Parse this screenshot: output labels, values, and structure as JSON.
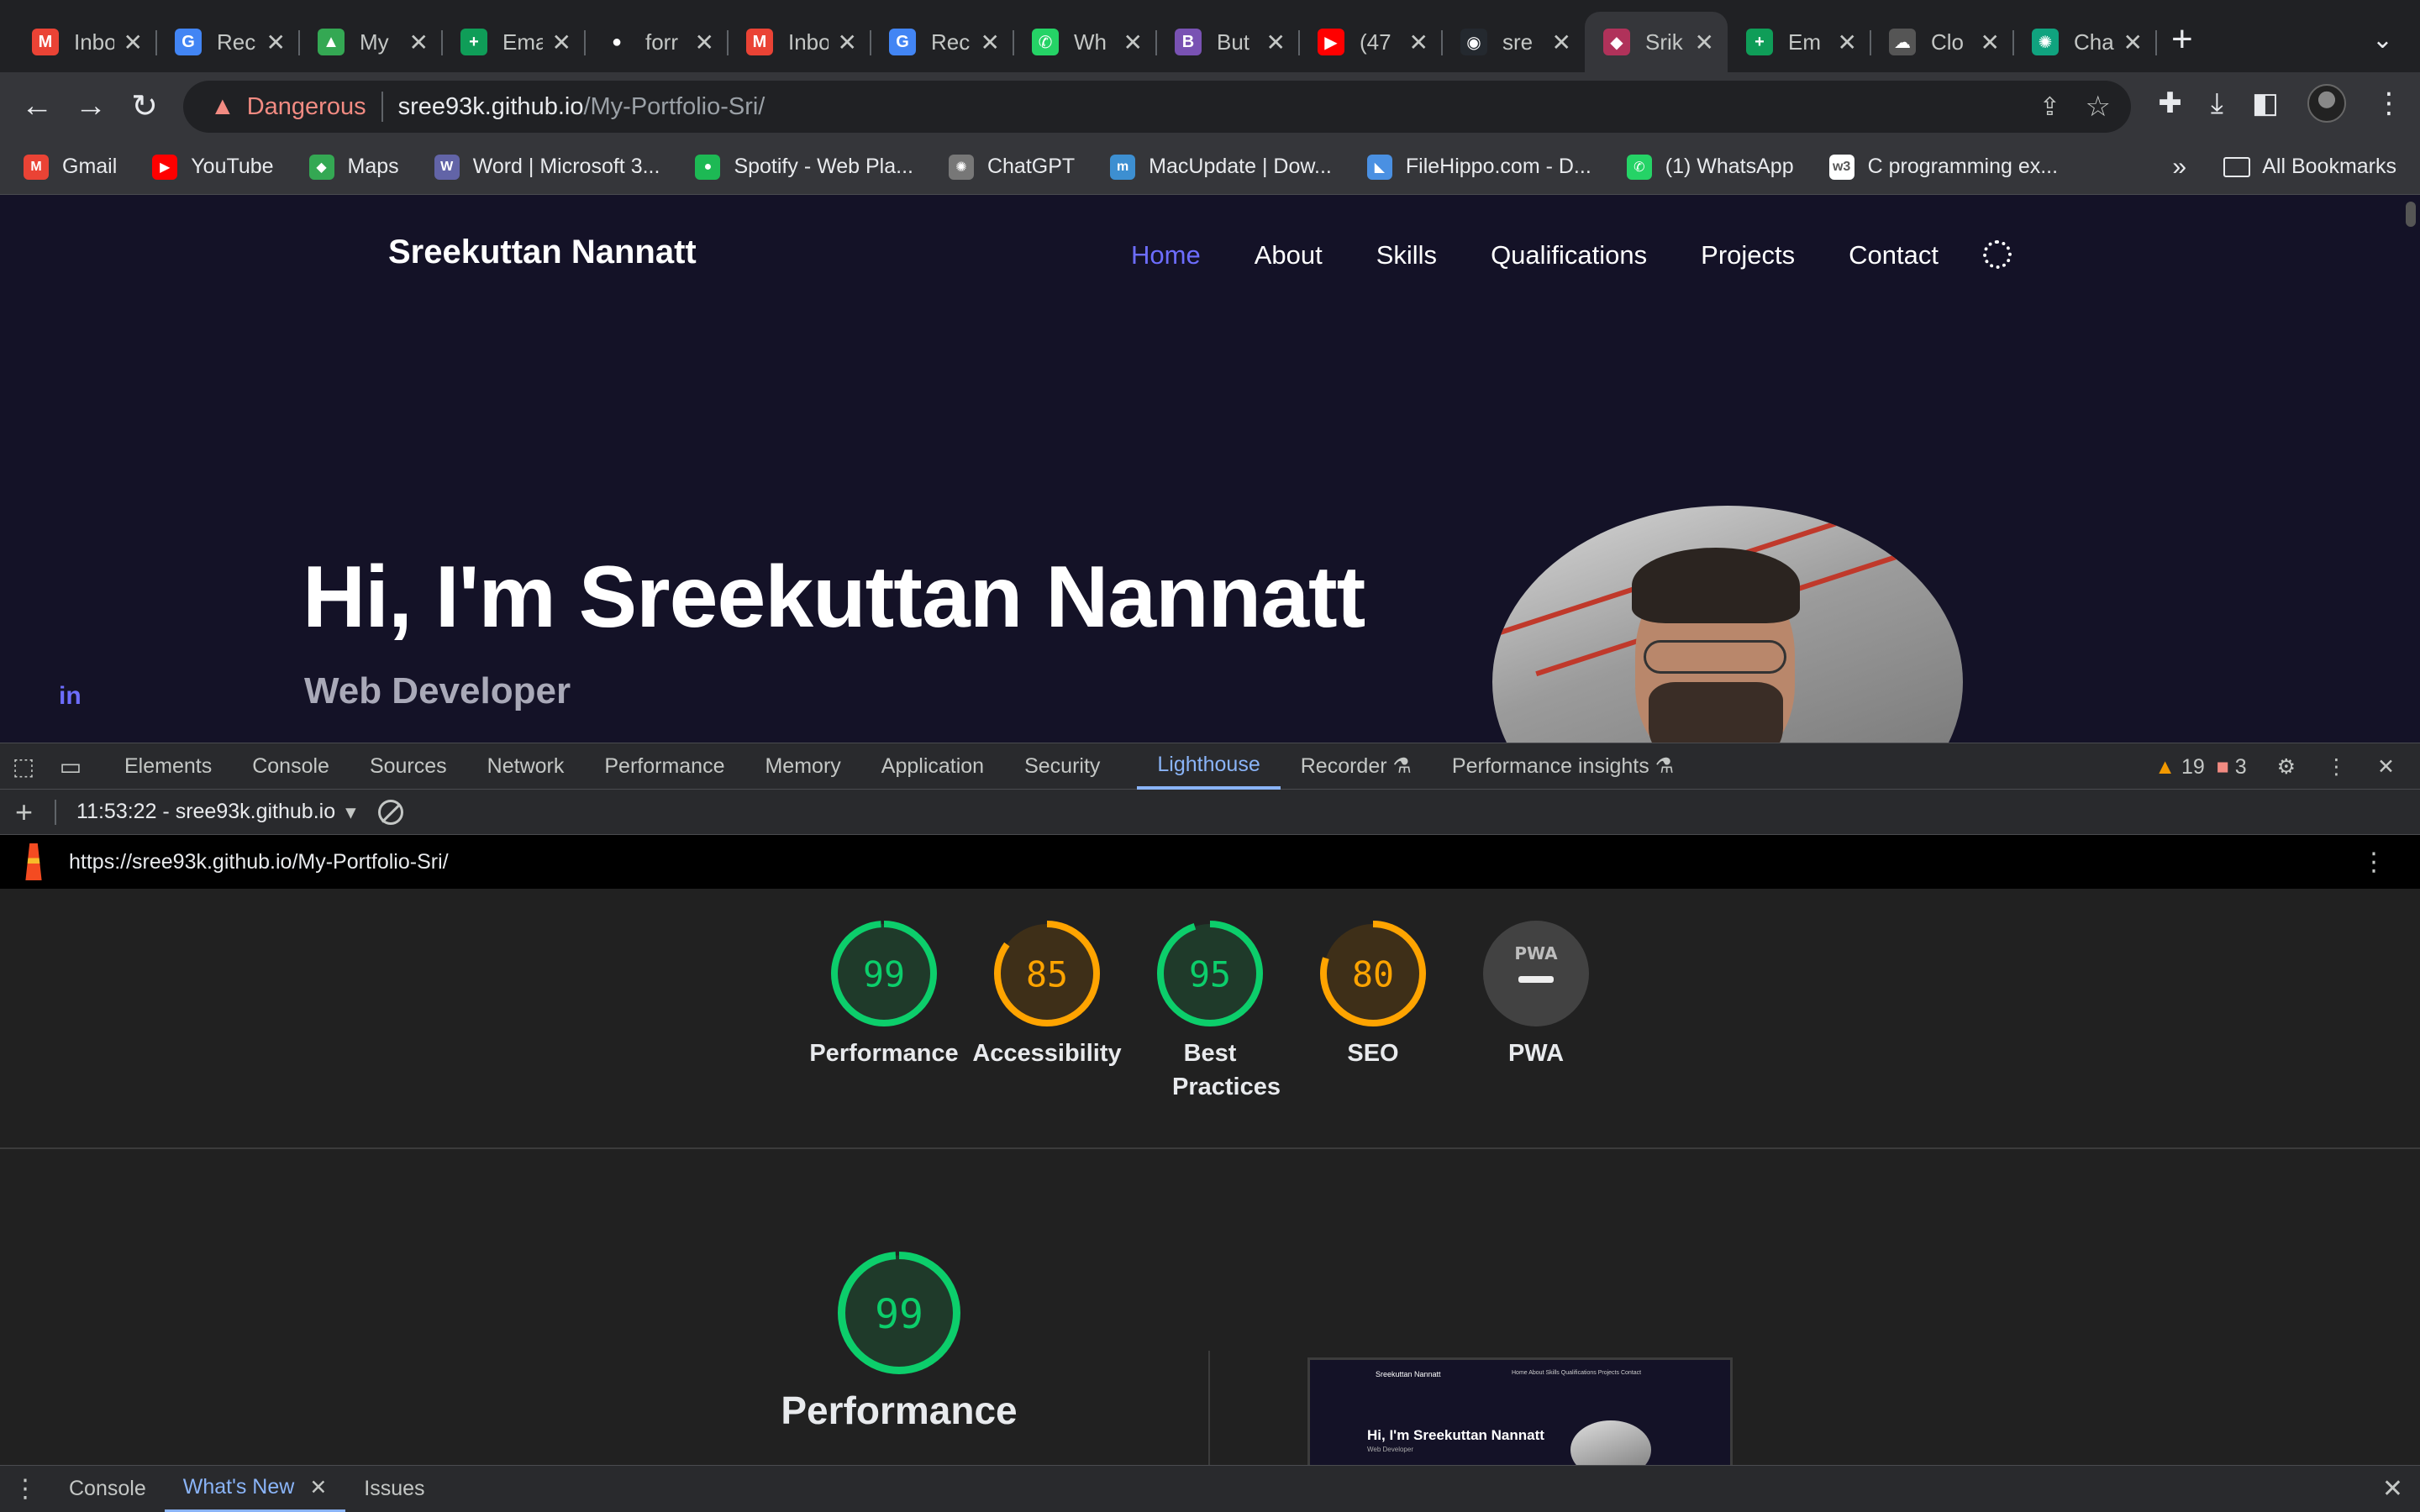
{
  "tabs": [
    {
      "title": "Inbo",
      "fav": "M",
      "color": "#ea4335"
    },
    {
      "title": "Rec",
      "fav": "G",
      "color": "#4285f4"
    },
    {
      "title": "My",
      "fav": "▲",
      "color": "#34a853"
    },
    {
      "title": "Ema",
      "fav": "+",
      "color": "#0f9d58"
    },
    {
      "title": "forr",
      "fav": "●",
      "color": "#202124"
    },
    {
      "title": "Inbo",
      "fav": "M",
      "color": "#ea4335"
    },
    {
      "title": "Rec",
      "fav": "G",
      "color": "#4285f4"
    },
    {
      "title": "Wh",
      "fav": "✆",
      "color": "#25d366"
    },
    {
      "title": "But",
      "fav": "B",
      "color": "#7952b3"
    },
    {
      "title": "(47",
      "fav": "▶",
      "color": "#ff0000"
    },
    {
      "title": "sre",
      "fav": "◉",
      "color": "#24292f"
    },
    {
      "title": "Srik",
      "fav": "◆",
      "color": "#b0325a"
    },
    {
      "title": "Em",
      "fav": "+",
      "color": "#0f9d58"
    },
    {
      "title": "Clo",
      "fav": "☁",
      "color": "#555"
    },
    {
      "title": "Cha",
      "fav": "✺",
      "color": "#10a37f"
    }
  ],
  "omnibox": {
    "warning": "Dangerous",
    "host": "sree93k.github.io",
    "path": "/My-Portfolio-Sri/"
  },
  "bookmarks": [
    {
      "label": "Gmail",
      "fav": "M",
      "color": "#ea4335"
    },
    {
      "label": "YouTube",
      "fav": "▶",
      "color": "#ff0000"
    },
    {
      "label": "Maps",
      "fav": "◆",
      "color": "#34a853"
    },
    {
      "label": "Word | Microsoft 3...",
      "fav": "W",
      "color": "#6264a7"
    },
    {
      "label": "Spotify - Web Pla...",
      "fav": "●",
      "color": "#1db954"
    },
    {
      "label": "ChatGPT",
      "fav": "✺",
      "color": "#777"
    },
    {
      "label": "MacUpdate | Dow...",
      "fav": "m",
      "color": "#3d8fd1"
    },
    {
      "label": "FileHippo.com - D...",
      "fav": "◣",
      "color": "#4a90e2"
    },
    {
      "label": "(1) WhatsApp",
      "fav": "✆",
      "color": "#25d366"
    },
    {
      "label": "C programming ex...",
      "fav": "w3",
      "color": "#ffffff"
    }
  ],
  "bookmarks_more": "»",
  "bookmarks_all": "All Bookmarks",
  "site": {
    "logo": "Sreekuttan Nannatt",
    "nav": [
      "Home",
      "About",
      "Skills",
      "Qualifications",
      "Projects",
      "Contact"
    ],
    "hero_title": "Hi, I'm Sreekuttan Nannatt",
    "hero_subtitle": "Web Developer",
    "social": "in"
  },
  "devtools": {
    "tabs": [
      "Elements",
      "Console",
      "Sources",
      "Network",
      "Performance",
      "Memory",
      "Application",
      "Security",
      "Lighthouse",
      "Recorder ⚗",
      "Performance insights ⚗"
    ],
    "active_tab": "Lighthouse",
    "warnings": "19",
    "errors": "3",
    "report_time": "11:53:22 - sree93k.github.io",
    "report_url": "https://sree93k.github.io/My-Portfolio-Sri/"
  },
  "lighthouse": {
    "scores": [
      {
        "label": "Performance",
        "score": 99,
        "color": "#0cce6b"
      },
      {
        "label": "Accessibility",
        "score": 85,
        "color": "#ffa400"
      },
      {
        "label": "Best Practices",
        "score": 95,
        "color": "#0cce6b"
      },
      {
        "label": "SEO",
        "score": 80,
        "color": "#ffa400"
      },
      {
        "label": "PWA",
        "score": null,
        "badge": "PWA",
        "color": "#9aa0a6"
      }
    ],
    "detail": {
      "label": "Performance",
      "score": 99
    },
    "thumbnail": {
      "logo": "Sreekuttan Nannatt",
      "nav": "Home  About  Skills  Qualifications  Projects  Contact",
      "title": "Hi, I'm Sreekuttan Nannatt",
      "sub": "Web Developer"
    }
  },
  "drawer": {
    "tabs": [
      "Console",
      "What's New",
      "Issues"
    ],
    "active": "What's New"
  }
}
